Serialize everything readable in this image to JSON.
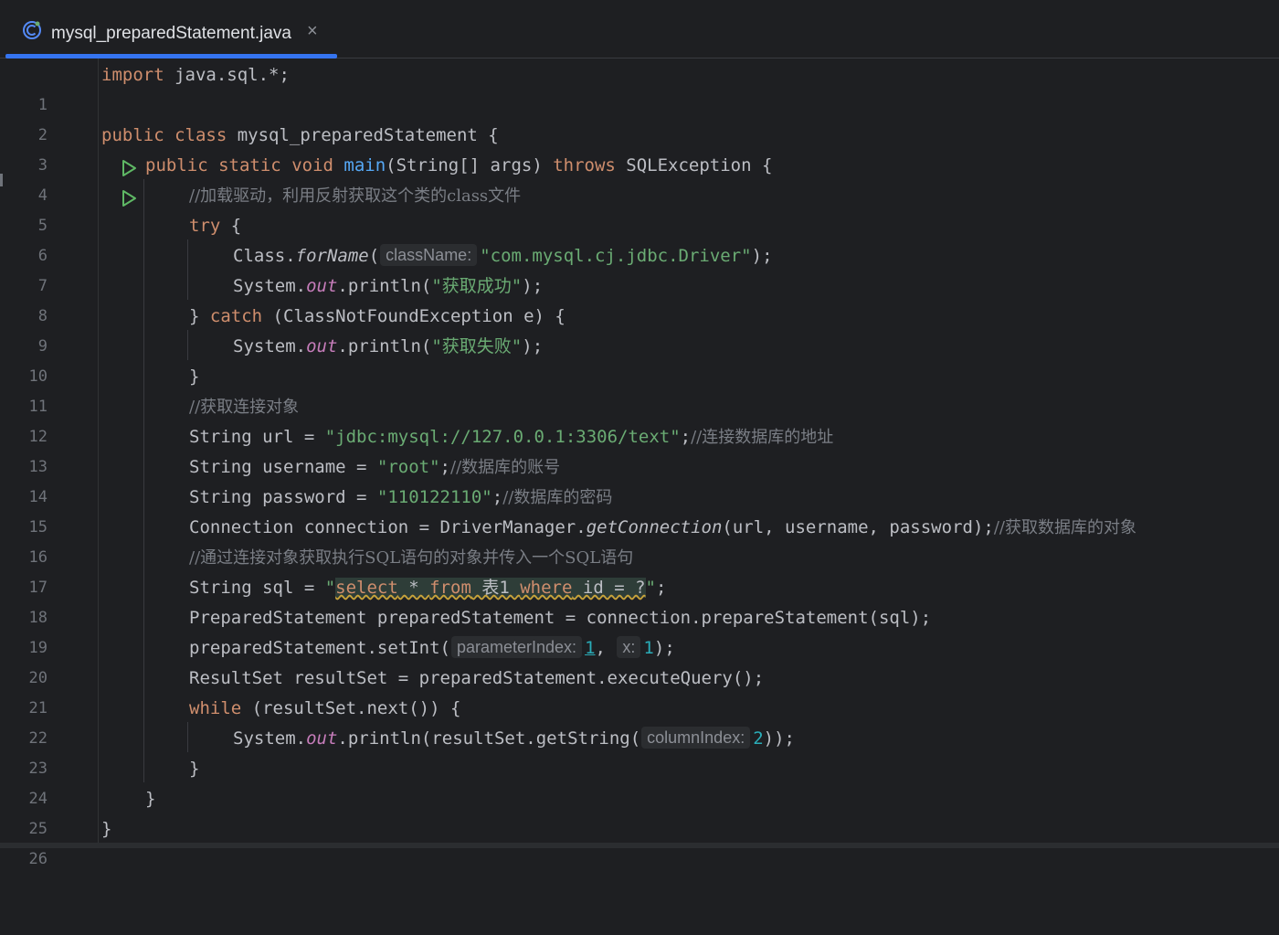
{
  "tab": {
    "filename": "mysql_preparedStatement.java",
    "close_symbol": "×",
    "accent_color": "#3574f0"
  },
  "icons": {
    "file": "java-class-icon",
    "run": "run-play-icon"
  },
  "colors": {
    "keyword": "#cf8e6d",
    "string": "#6aab73",
    "comment": "#7a7e85",
    "function": "#56a8f5",
    "static_field": "#c77dbb",
    "number": "#2aacb8",
    "background": "#1e1f22"
  },
  "editor": {
    "lines": [
      {
        "n": "1",
        "run": false,
        "t": {
          "a": "import",
          "b": " java.sql.*;"
        }
      },
      {
        "n": "2",
        "run": false
      },
      {
        "n": "3",
        "run": true,
        "t": {
          "a": "public",
          "b": " ",
          "c": "class",
          "d": " mysql_preparedStatement {"
        }
      },
      {
        "n": "4",
        "run": true,
        "t": {
          "a": "public",
          "b": " ",
          "c": "static",
          "d": " ",
          "e": "void",
          "f": " ",
          "g": "main",
          "h": "(String[] args) ",
          "i": "throws",
          "j": " SQLException {"
        }
      },
      {
        "n": "5",
        "run": false,
        "t": {
          "a": "//加载驱动，利用反射获取这个类的class文件"
        }
      },
      {
        "n": "6",
        "run": false,
        "t": {
          "a": "try",
          "b": " {"
        }
      },
      {
        "n": "7",
        "run": false,
        "t": {
          "a": "Class.",
          "b": "forName",
          "c": "(",
          "hint": "className:",
          "d": "\"com.mysql.cj.jdbc.Driver\"",
          "e": ");"
        }
      },
      {
        "n": "8",
        "run": false,
        "t": {
          "a": "System.",
          "b": "out",
          "c": ".println(",
          "d": "\"获取成功\"",
          "e": ");"
        }
      },
      {
        "n": "9",
        "run": false,
        "t": {
          "a": "} ",
          "b": "catch",
          "c": " (ClassNotFoundException e) {"
        }
      },
      {
        "n": "10",
        "run": false,
        "t": {
          "a": "System.",
          "b": "out",
          "c": ".println(",
          "d": "\"获取失败\"",
          "e": ");"
        }
      },
      {
        "n": "11",
        "run": false,
        "t": {
          "a": "}"
        }
      },
      {
        "n": "12",
        "run": false,
        "t": {
          "a": "//获取连接对象"
        }
      },
      {
        "n": "13",
        "run": false,
        "t": {
          "a": "String url = ",
          "b": "\"jdbc:mysql://127.0.0.1:3306/text\"",
          "c": ";",
          "d": "//连接数据库的地址"
        }
      },
      {
        "n": "14",
        "run": false,
        "t": {
          "a": "String username = ",
          "b": "\"root\"",
          "c": ";",
          "d": "//数据库的账号"
        }
      },
      {
        "n": "15",
        "run": false,
        "t": {
          "a": "String password = ",
          "b": "\"110122110\"",
          "c": ";",
          "d": "//数据库的密码"
        }
      },
      {
        "n": "16",
        "run": false,
        "t": {
          "a": "Connection connection = DriverManager.",
          "b": "getConnection",
          "c": "(url, username, password);",
          "d": "//获取数据库的对象"
        }
      },
      {
        "n": "17",
        "run": false,
        "t": {
          "a": "//通过连接对象获取执行SQL语句的对象并传入一个SQL语句"
        }
      },
      {
        "n": "18",
        "run": false,
        "t": {
          "a": "String sql = ",
          "q1": "\"",
          "s1": "select",
          "s2": " * ",
          "s3": "from",
          "s4": " 表1 ",
          "s5": "where",
          "s6": " id = ?",
          "q2": "\"",
          "e": ";"
        }
      },
      {
        "n": "19",
        "run": false,
        "t": {
          "a": "PreparedStatement preparedStatement = connection.prepareStatement(sql);"
        }
      },
      {
        "n": "20",
        "run": false,
        "t": {
          "a": "preparedStatement.setInt(",
          "hint1": "parameterIndex:",
          "b": "1",
          "c": ", ",
          "hint2": "x:",
          "d": "1",
          "e": ");"
        }
      },
      {
        "n": "21",
        "run": false,
        "t": {
          "a": "ResultSet resultSet = preparedStatement.executeQuery();"
        }
      },
      {
        "n": "22",
        "run": false,
        "t": {
          "a": "while",
          "b": " (resultSet.next()) {"
        }
      },
      {
        "n": "23",
        "run": false,
        "t": {
          "a": "System.",
          "b": "out",
          "c": ".println(resultSet.getString(",
          "hint": "columnIndex:",
          "d": "2",
          "e": "));"
        }
      },
      {
        "n": "24",
        "run": false,
        "t": {
          "a": "}"
        }
      },
      {
        "n": "25",
        "run": false,
        "t": {
          "a": "}"
        }
      },
      {
        "n": "26",
        "run": false,
        "t": {
          "a": "}"
        }
      }
    ]
  }
}
